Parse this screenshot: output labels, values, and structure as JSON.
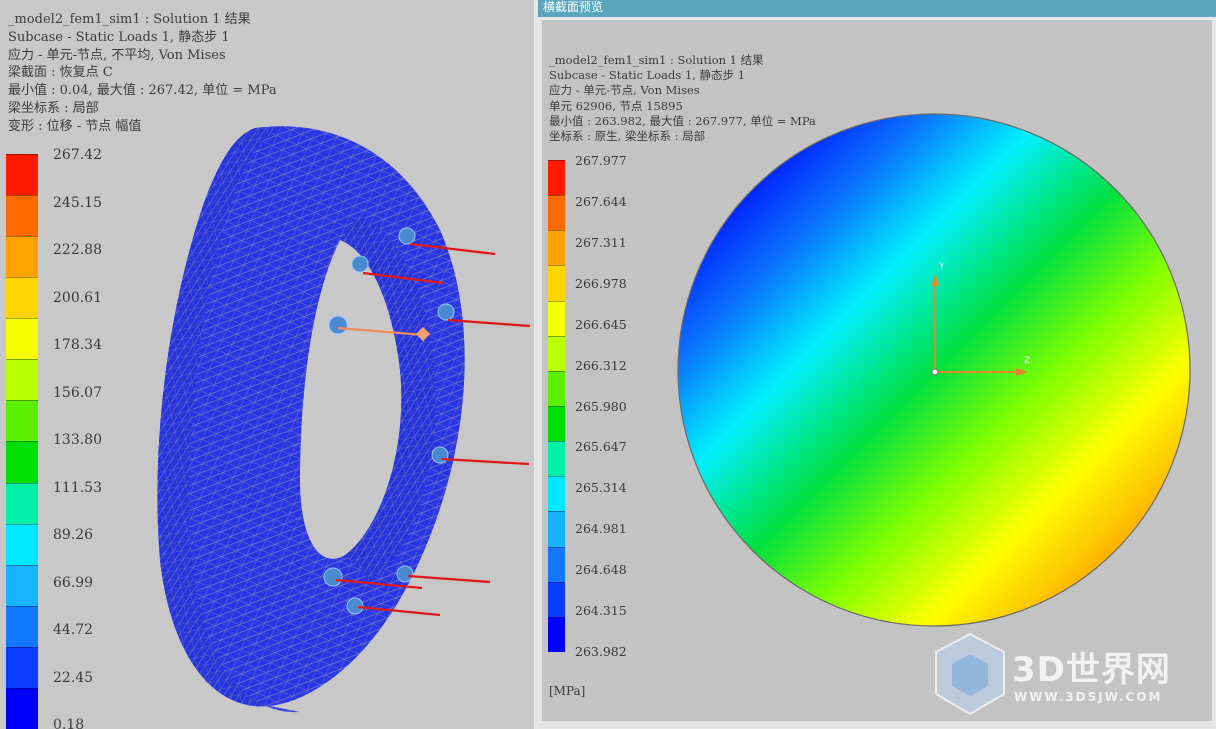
{
  "left_panel": {
    "info_lines": [
      "_model2_fem1_sim1 : Solution 1 结果",
      "Subcase - Static Loads 1, 静态步 1",
      "应力 - 单元-节点, 不平均, Von Mises",
      "梁截面 : 恢复点 C",
      "最小值 : 0.04, 最大值 : 267.42, 单位 = MPa",
      "梁坐标系 : 局部",
      "变形 : 位移 - 节点 幅值"
    ],
    "legend_ticks": [
      "267.42",
      "245.15",
      "222.88",
      "200.61",
      "178.34",
      "156.07",
      "133.80",
      "111.53",
      "89.26",
      "66.99",
      "44.72",
      "22.45",
      "0.18"
    ],
    "legend_colors": [
      "#ff1a00",
      "#ff6a00",
      "#ffa200",
      "#ffd400",
      "#f5ff00",
      "#b8ff00",
      "#5cf000",
      "#00e000",
      "#00f0a8",
      "#00e8ff",
      "#18b4ff",
      "#1478ff",
      "#0a3cff",
      "#0000ff"
    ]
  },
  "section_preview": {
    "title": "横截面预览",
    "info_lines": [
      "_model2_fem1_sim1 : Solution 1 结果",
      "Subcase - Static Loads 1, 静态步 1",
      "应力 - 单元-节点, Von Mises",
      "单元 62906, 节点 15895",
      "最小值 : 263.982, 最大值 : 267.977, 单位 = MPa",
      "坐标系 : 原生, 梁坐标系 : 局部"
    ],
    "legend_ticks": [
      "267.977",
      "267.644",
      "267.311",
      "266.978",
      "266.645",
      "266.312",
      "265.980",
      "265.647",
      "265.314",
      "264.981",
      "264.648",
      "264.315",
      "263.982"
    ],
    "legend_colors": [
      "#ff1a00",
      "#ff6a00",
      "#ffa200",
      "#ffd400",
      "#f5ff00",
      "#b8ff00",
      "#5cf000",
      "#00e000",
      "#00f0a8",
      "#00e8ff",
      "#18b4ff",
      "#1478ff",
      "#0a3cff",
      "#0000ff"
    ],
    "unit": "[MPa]",
    "axis_y": "Y",
    "axis_z": "Z"
  },
  "watermark": {
    "brand": "3D世界网",
    "url": "WWW.3DSJW.COM"
  }
}
